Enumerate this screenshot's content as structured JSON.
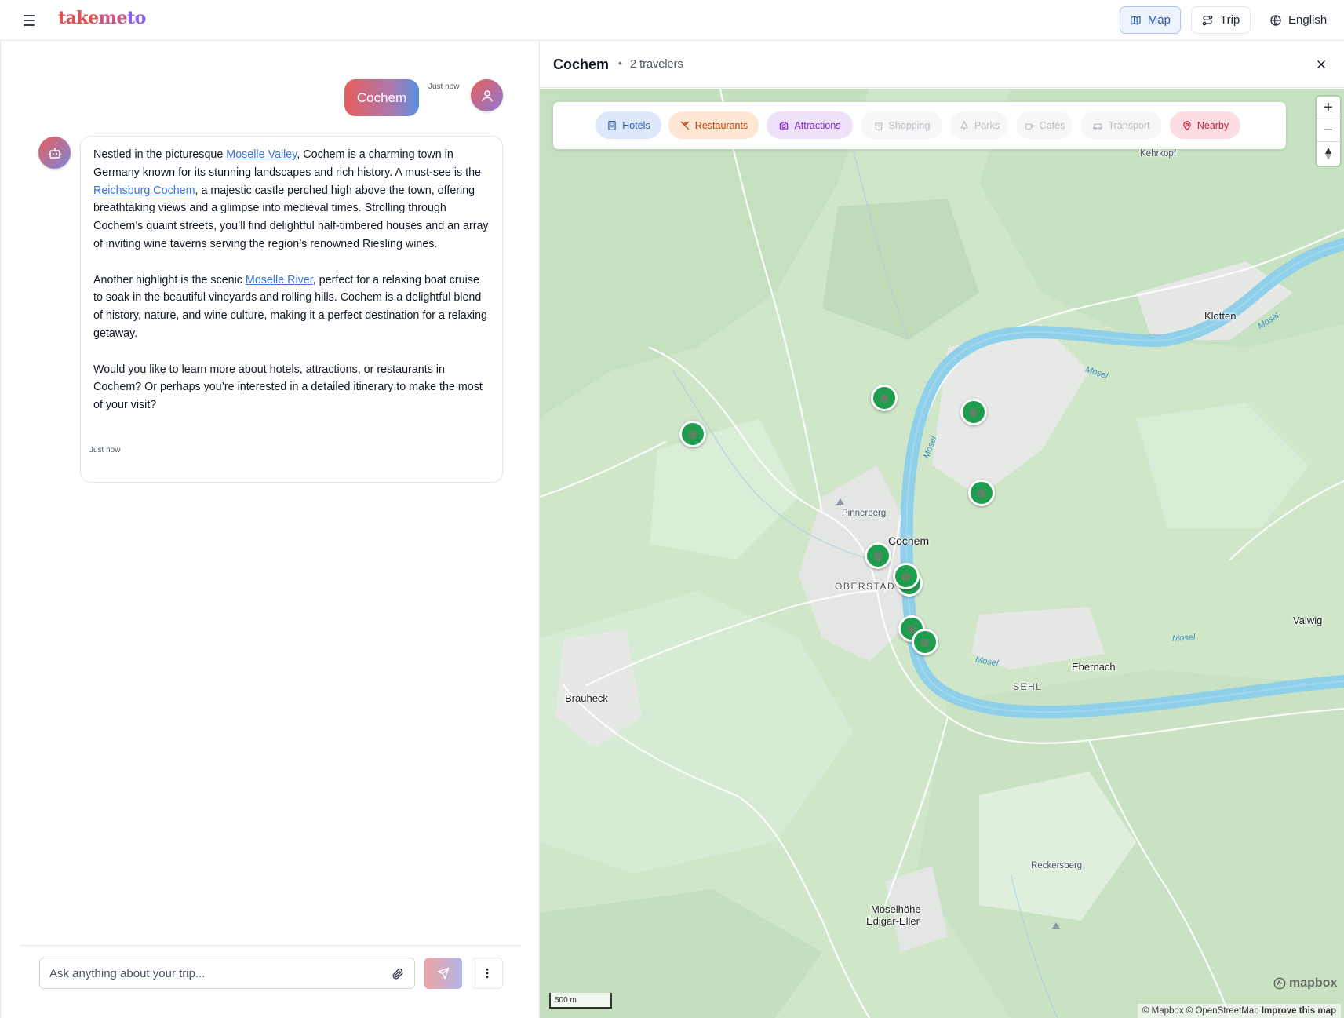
{
  "header": {
    "logo_part1": "take",
    "logo_part2": "me",
    "logo_part3": "to",
    "map_label": "Map",
    "trip_label": "Trip",
    "language_label": "English"
  },
  "chat": {
    "user_message": "Cochem",
    "user_timestamp": "Just now",
    "bot_timestamp": "Just now",
    "bot_message": {
      "p1_before": "Nestled in the picturesque ",
      "p1_link1": "Moselle Valley",
      "p1_mid": ", Cochem is a charming town in Germany known for its stunning landscapes and rich history. A must-see is the ",
      "p1_link2": "Reichsburg Cochem",
      "p1_after": ", a majestic castle perched high above the town, offering breathtaking views and a glimpse into medieval times. Strolling through Cochem’s quaint streets, you’ll find delightful half-timbered houses and an array of inviting wine taverns serving the region’s renowned Riesling wines.",
      "p2_before": "Another highlight is the scenic ",
      "p2_link": "Moselle River",
      "p2_after": ", perfect for a relaxing boat cruise to soak in the beautiful vineyards and rolling hills. Cochem is a delightful blend of history, nature, and wine culture, making it a perfect destination for a relaxing getaway.",
      "p3": "Would you like to learn more about hotels, attractions, or restaurants in Cochem? Or perhaps you’re interested in a detailed itinerary to make the most of your visit?"
    },
    "input_placeholder": "Ask anything about your trip..."
  },
  "map_panel": {
    "title": "Cochem",
    "separator": "•",
    "travelers": "2 travelers",
    "filters": [
      {
        "label": "Hotels",
        "active": true,
        "color": "#2d5aa8",
        "bg": "#dde8fb"
      },
      {
        "label": "Restaurants",
        "active": true,
        "color": "#c2410c",
        "bg": "#fde6d2"
      },
      {
        "label": "Attractions",
        "active": true,
        "color": "#7e22ce",
        "bg": "#f0e1fb"
      },
      {
        "label": "Shopping",
        "active": false,
        "color": "#b8bcc4",
        "bg": "#f7f7f8"
      },
      {
        "label": "Parks",
        "active": false,
        "color": "#b8bcc4",
        "bg": "#f7f7f8"
      },
      {
        "label": "Cafés",
        "active": false,
        "color": "#b8bcc4",
        "bg": "#f7f7f8"
      },
      {
        "label": "Transport",
        "active": false,
        "color": "#b8bcc4",
        "bg": "#f7f7f8"
      },
      {
        "label": "Nearby",
        "active": true,
        "color": "#c81e3a",
        "bg": "#fcdde1"
      }
    ],
    "zoom_in": "+",
    "zoom_out": "−",
    "scale": "500 m",
    "attribution_text": "© Mapbox © OpenStreetMap ",
    "attribution_link": "Improve this map",
    "mapbox_logo": "mapbox",
    "places": {
      "kehrkopf": "Kehrkopf",
      "klotten": "Klotten",
      "pinnerberg": "Pinnerberg",
      "cochem": "Cochem",
      "oberstadt": "OBERSTADT",
      "valwig": "Valwig",
      "ebernach": "Ebernach",
      "sehl": "SEHL",
      "brauheck": "Brauheck",
      "reckersberg": "Reckersberg",
      "moselhoehe": "Moselhöhe",
      "ediger": "Edigar-Eller"
    },
    "river_label": "Mosel",
    "river_label_alt": "Mosel",
    "marker_icon": "target-icon",
    "marker_count": 10
  },
  "colors": {
    "accent_blue": "#2d5aa8",
    "marker_green": "#1f9d4f",
    "river": "#8fcfe9",
    "land": "#cfe7cc"
  }
}
